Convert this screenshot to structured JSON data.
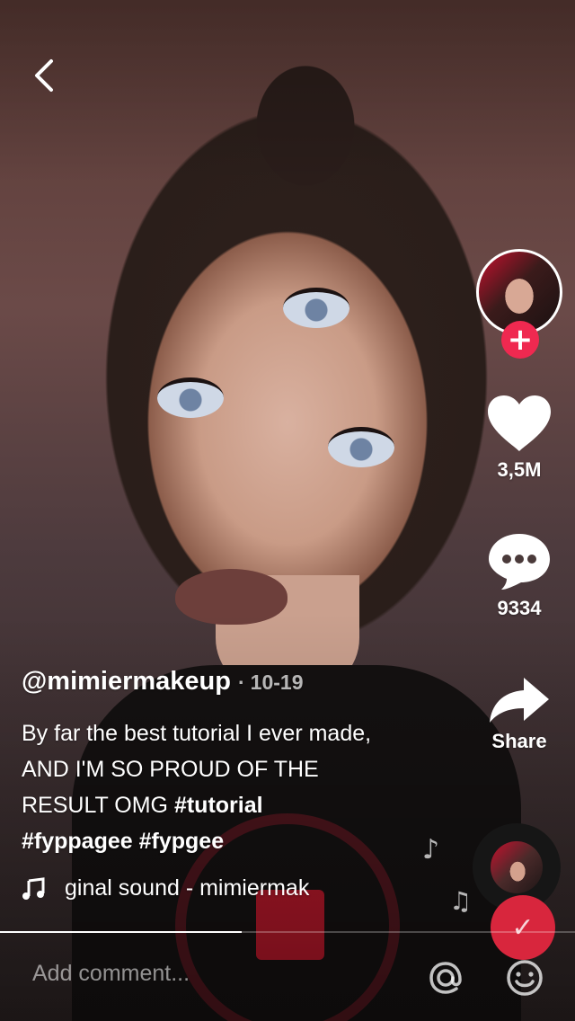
{
  "video": {
    "description": ""
  },
  "nav": {
    "back_icon": "chevron-left-icon"
  },
  "creator": {
    "username": "@mimiermakeup",
    "date_sep": "·",
    "date": "10-19",
    "follow_icon": "plus-icon"
  },
  "actions": {
    "like_count": "3,5M",
    "comment_count": "9334",
    "share_label": "Share"
  },
  "caption": {
    "text": "By far the best tutorial I ever made, AND I'M SO PROUD OF THE RESULT OMG ",
    "tags": [
      "#tutorial",
      "#fyppagee",
      "#fypgee"
    ]
  },
  "sound": {
    "label": "ginal sound - mimiermak"
  },
  "progress": {
    "fraction": 0.42
  },
  "comment_bar": {
    "placeholder": "Add comment...",
    "mention_icon": "at-icon",
    "emoji_icon": "smiley-icon"
  },
  "colors": {
    "accent": "#ef2950",
    "record": "#d8263d",
    "text": "#ffffff"
  }
}
